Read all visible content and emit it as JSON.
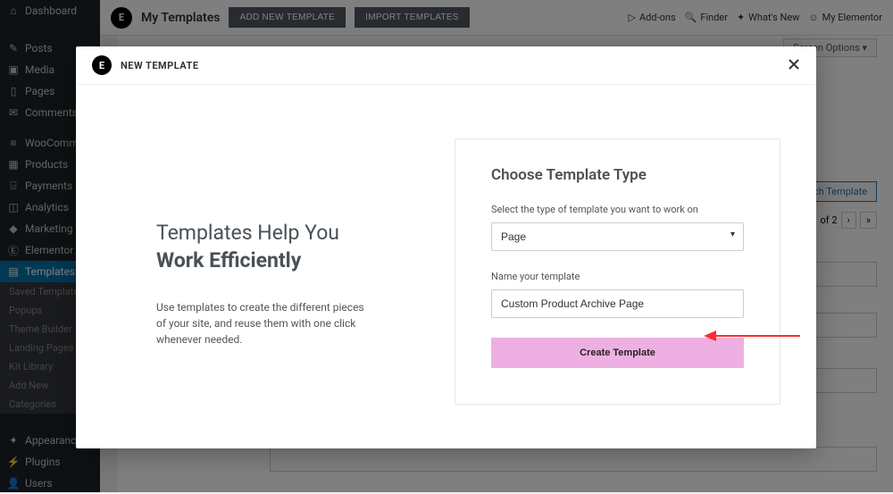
{
  "sidebar": {
    "items": [
      {
        "label": "Dashboard",
        "icon": "⌂"
      },
      {
        "label": "Posts",
        "icon": "✎"
      },
      {
        "label": "Media",
        "icon": "▣"
      },
      {
        "label": "Pages",
        "icon": "▯"
      },
      {
        "label": "Comments",
        "icon": "✉"
      },
      {
        "label": "WooComme...",
        "icon": "≡"
      },
      {
        "label": "Products",
        "icon": "▦"
      },
      {
        "label": "Payments",
        "icon": "⌸"
      },
      {
        "label": "Analytics",
        "icon": "◫"
      },
      {
        "label": "Marketing",
        "icon": "◆"
      },
      {
        "label": "Elementor",
        "icon": "Ⓔ"
      },
      {
        "label": "Templates",
        "icon": "▤"
      }
    ],
    "subitems": [
      "Saved Templates",
      "Popups",
      "Theme Builder",
      "Landing Pages",
      "Kit Library",
      "Add New",
      "Categories"
    ],
    "footer": [
      {
        "label": "Appearance",
        "icon": "✦"
      },
      {
        "label": "Plugins",
        "icon": "⚡"
      },
      {
        "label": "Users",
        "icon": "👤"
      }
    ]
  },
  "topbar": {
    "title": "My Templates",
    "add_label": "ADD NEW TEMPLATE",
    "import_label": "IMPORT TEMPLATES",
    "addons": "Add-ons",
    "finder": "Finder",
    "whatsnew": "What's New",
    "myelementor": "My Elementor"
  },
  "main": {
    "screen_options": "Screen Options ▾",
    "search_template": "...ch Template",
    "pager_text": "of 2",
    "pager_next": "›",
    "pager_last": "»"
  },
  "modal": {
    "header_title": "NEW TEMPLATE",
    "left_h_line1": "Templates Help You",
    "left_h_line2": "Work Efficiently",
    "left_p": "Use templates to create the different pieces of your site, and reuse them with one click whenever needed.",
    "right_title": "Choose Template Type",
    "select_label": "Select the type of template you want to work on",
    "select_value": "Page",
    "name_label": "Name your template",
    "name_value": "Custom Product Archive Page",
    "create_label": "Create Template"
  }
}
